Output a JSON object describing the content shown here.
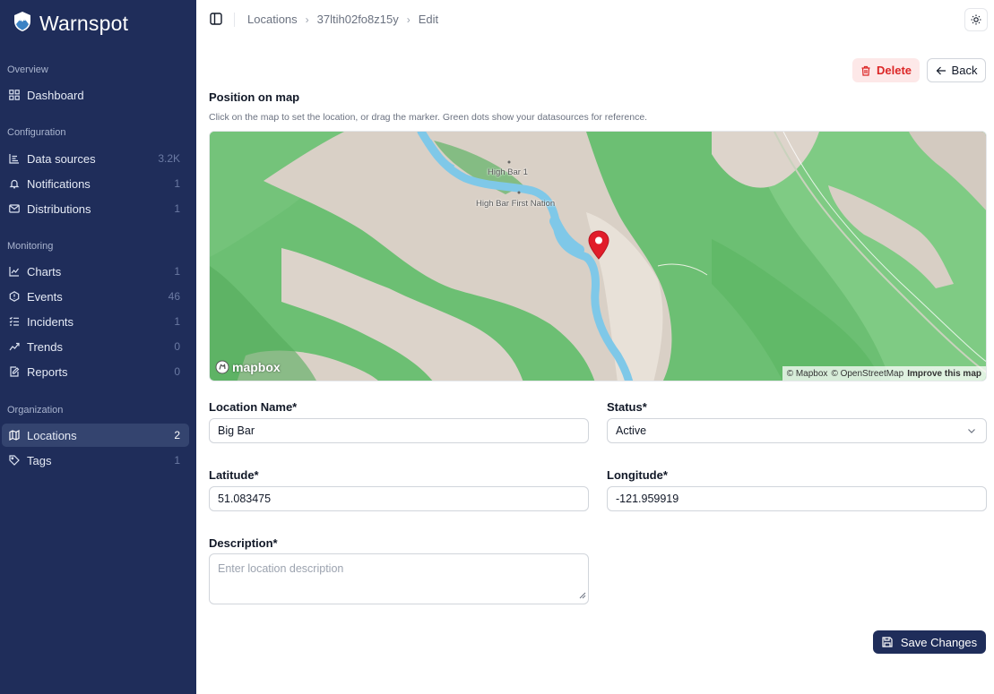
{
  "app": {
    "name": "Warnspot"
  },
  "sidebar": {
    "sections": [
      {
        "title": "Overview",
        "items": [
          {
            "label": "Dashboard",
            "icon": "grid-icon"
          }
        ]
      },
      {
        "title": "Configuration",
        "items": [
          {
            "label": "Data sources",
            "count": "3.2K",
            "icon": "list-icon"
          },
          {
            "label": "Notifications",
            "count": "1",
            "icon": "bell-icon"
          },
          {
            "label": "Distributions",
            "count": "1",
            "icon": "mail-icon"
          }
        ]
      },
      {
        "title": "Monitoring",
        "items": [
          {
            "label": "Charts",
            "count": "1",
            "icon": "line-chart-icon"
          },
          {
            "label": "Events",
            "count": "46",
            "icon": "alert-circle-icon"
          },
          {
            "label": "Incidents",
            "count": "1",
            "icon": "list-checks-icon"
          },
          {
            "label": "Trends",
            "count": "0",
            "icon": "trend-icon"
          },
          {
            "label": "Reports",
            "count": "0",
            "icon": "report-icon"
          }
        ]
      },
      {
        "title": "Organization",
        "items": [
          {
            "label": "Locations",
            "count": "2",
            "icon": "map-icon",
            "active": true
          },
          {
            "label": "Tags",
            "count": "1",
            "icon": "tag-icon"
          }
        ]
      }
    ]
  },
  "breadcrumb": {
    "items": [
      "Locations",
      "37ltih02fo8z15y",
      "Edit"
    ]
  },
  "actions": {
    "delete": "Delete",
    "back": "Back"
  },
  "map_section": {
    "title": "Position on map",
    "hint": "Click on the map to set the location, or drag the marker. Green dots show your datasources for reference.",
    "labels": [
      "High Bar 1",
      "High Bar First Nation"
    ],
    "logo": "mapbox",
    "attribution": {
      "mapbox": "© Mapbox",
      "osm": "© OpenStreetMap",
      "improve": "Improve this map"
    }
  },
  "form": {
    "name": {
      "label": "Location Name*",
      "value": "Big Bar"
    },
    "status": {
      "label": "Status*",
      "value": "Active"
    },
    "latitude": {
      "label": "Latitude*",
      "value": "51.083475"
    },
    "longitude": {
      "label": "Longitude*",
      "value": "-121.959919"
    },
    "description": {
      "label": "Description*",
      "placeholder": "Enter location description"
    }
  },
  "save": {
    "label": "Save Changes"
  },
  "colors": {
    "sidebar": "#1f2d5a",
    "active_item": "#34446f",
    "danger": "#dc2626",
    "danger_bg": "#fde8e8",
    "primary": "#1f2d5a",
    "marker": "#e11d2a"
  }
}
